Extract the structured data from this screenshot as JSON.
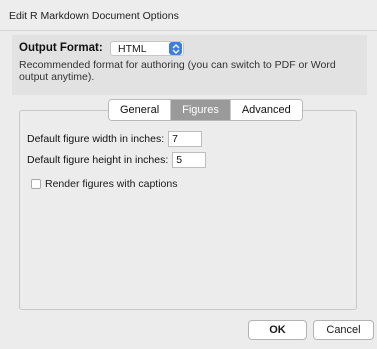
{
  "window": {
    "title": "Edit R Markdown Document Options"
  },
  "output_format": {
    "label": "Output Format:",
    "selected": "HTML",
    "description": "Recommended format for authoring (you can switch to PDF or Word output anytime)."
  },
  "tabs": [
    {
      "label": "General",
      "active": false
    },
    {
      "label": "Figures",
      "active": true
    },
    {
      "label": "Advanced",
      "active": false
    }
  ],
  "figures": {
    "width_label": "Default figure width in inches:",
    "width_value": "7",
    "height_label": "Default figure height in inches:",
    "height_value": "5",
    "captions_label": "Render figures with captions",
    "captions_checked": false
  },
  "buttons": {
    "ok": "OK",
    "cancel": "Cancel"
  },
  "colors": {
    "accent": "#3a7de9",
    "active_tab": "#9a9a9a"
  },
  "icons": {
    "format_select": "chevron-up-down-icon"
  }
}
